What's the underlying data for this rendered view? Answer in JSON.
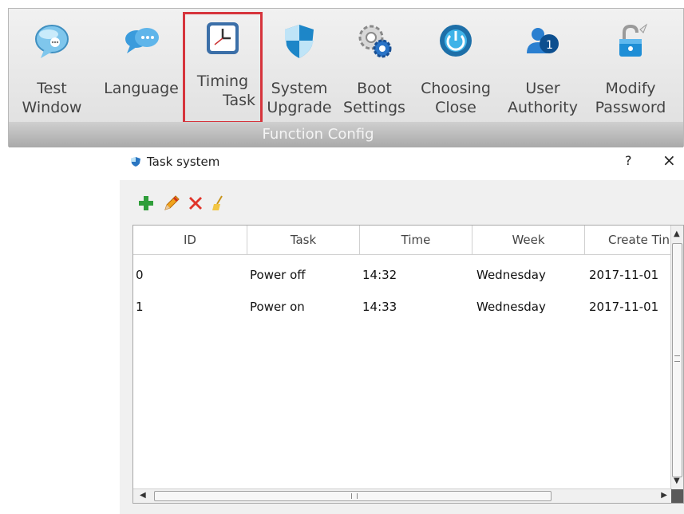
{
  "ribbon": {
    "buttons": [
      {
        "line1": "Test",
        "line2": "Window",
        "icon": "chat-bubble-icon"
      },
      {
        "line1": "Language",
        "line2": "",
        "icon": "speech-bubbles-icon"
      },
      {
        "line1": "Timing",
        "line2": "Task",
        "icon": "clock-icon"
      },
      {
        "line1": "System",
        "line2": "Upgrade",
        "icon": "shield-icon"
      },
      {
        "line1": "Boot",
        "line2": "Settings",
        "icon": "gear-icon"
      },
      {
        "line1": "Choosing",
        "line2": "Close",
        "icon": "power-icon"
      },
      {
        "line1": "User",
        "line2": "Authority",
        "icon": "users-icon"
      },
      {
        "line1": "Modify",
        "line2": "Password",
        "icon": "lock-icon"
      }
    ],
    "group_label": "Function Config",
    "selected": "Timing Task",
    "highlight_color": "#d6343c"
  },
  "dialog": {
    "title": "Task system",
    "help": "?",
    "close": "×",
    "toolbar": {
      "add_icon": "plus-icon",
      "edit_icon": "pencil-icon",
      "delete_icon": "x-icon",
      "clear_icon": "broom-icon"
    },
    "table": {
      "columns": [
        "ID",
        "Task",
        "Time",
        "Week",
        "Create Tin"
      ],
      "rows": [
        [
          "0",
          "Power off",
          "14:32",
          "Wednesday",
          "2017-11-01"
        ],
        [
          "1",
          "Power on",
          "14:33",
          "Wednesday",
          "2017-11-01"
        ]
      ]
    }
  }
}
